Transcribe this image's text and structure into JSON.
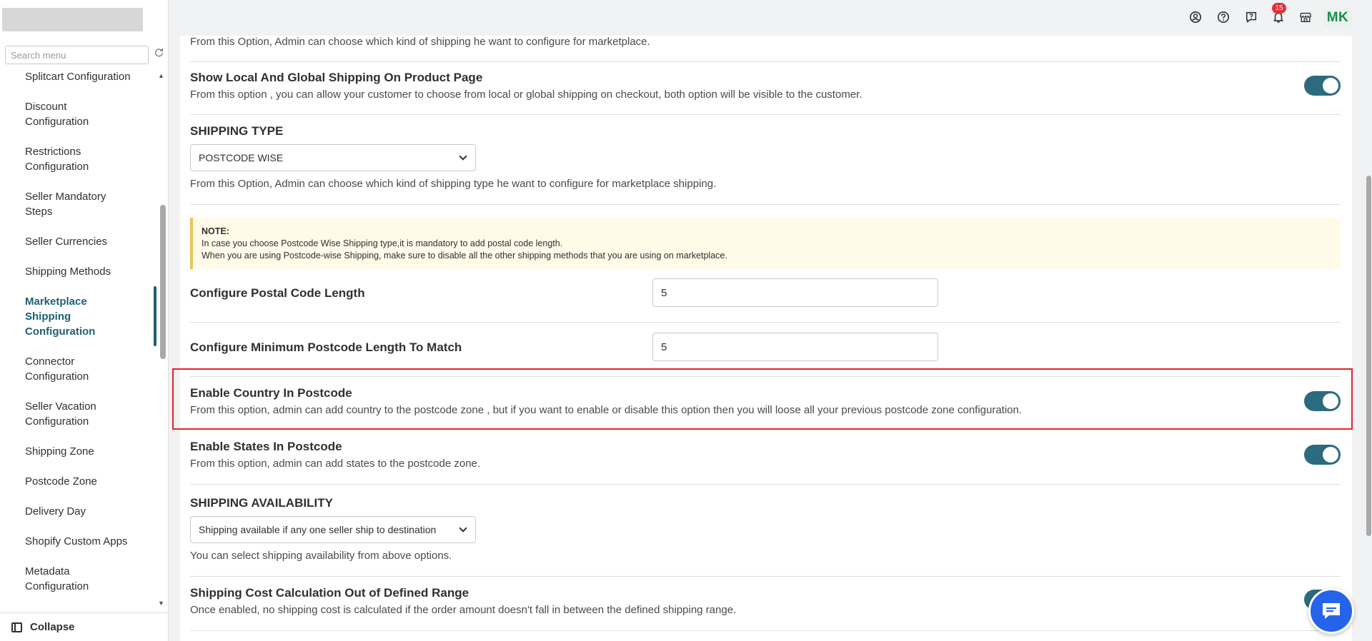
{
  "sidebar": {
    "search_placeholder": "Search menu",
    "items": [
      {
        "label": "Splitcart Configuration"
      },
      {
        "label": "Discount Configuration"
      },
      {
        "label": "Restrictions Configuration"
      },
      {
        "label": "Seller Mandatory Steps"
      },
      {
        "label": "Seller Currencies"
      },
      {
        "label": "Shipping Methods"
      },
      {
        "label": "Marketplace Shipping Configuration"
      },
      {
        "label": "Connector Configuration"
      },
      {
        "label": "Seller Vacation Configuration"
      },
      {
        "label": "Shipping Zone"
      },
      {
        "label": "Postcode Zone"
      },
      {
        "label": "Delivery Day"
      },
      {
        "label": "Shopify Custom Apps"
      },
      {
        "label": "Metadata Configuration"
      }
    ],
    "collapse_label": "Collapse"
  },
  "topbar": {
    "notification_count": "15",
    "avatar_initials": "MK",
    "icons": [
      "user-circle-icon",
      "help-circle-icon",
      "chat-question-icon",
      "bell-icon",
      "store-icon"
    ]
  },
  "settings": {
    "top_desc": "From this Option, Admin can choose which kind of shipping he want to configure for marketplace.",
    "local_global": {
      "title": "Show Local And Global Shipping On Product Page",
      "desc": "From this option , you can allow your customer to choose from local or global shipping on checkout, both option will be visible to the customer.",
      "enabled": true
    },
    "shipping_type": {
      "title": "SHIPPING TYPE",
      "value": "POSTCODE WISE",
      "desc": "From this Option, Admin can choose which kind of shipping type he want to configure for marketplace shipping."
    },
    "note": {
      "title": "NOTE:",
      "line1": "In case you choose Postcode Wise Shipping type,it is mandatory to add postal code length.",
      "line2": "When you are using Postcode-wise Shipping, make sure to disable all the other shipping methods that you are using on marketplace."
    },
    "postal_code_length": {
      "label": "Configure Postal Code Length",
      "value": "5"
    },
    "min_postcode_length": {
      "label": "Configure Minimum Postcode Length To Match",
      "value": "5"
    },
    "country_in_postcode": {
      "title": "Enable Country In Postcode",
      "desc": "From this option, admin can add country to the postcode zone , but if you want to enable or disable this option then you will loose all your previous postcode zone configuration.",
      "enabled": true
    },
    "states_in_postcode": {
      "title": "Enable States In Postcode",
      "desc": "From this option, admin can add states to the postcode zone.",
      "enabled": true
    },
    "availability": {
      "title": "SHIPPING AVAILABILITY",
      "value": "Shipping available if any one seller ship to destination",
      "desc": "You can select shipping availability from above options."
    },
    "cost_out_of_range": {
      "title": "Shipping Cost Calculation Out of Defined Range",
      "desc": "Once enabled, no shipping cost is calculated if the order amount doesn't fall in between the defined shipping range.",
      "enabled": true
    }
  },
  "colors": {
    "accent": "#2c6b7e",
    "active_menu": "#1f5f74",
    "highlight_border": "#e52329",
    "chat_button": "#2563eb"
  }
}
